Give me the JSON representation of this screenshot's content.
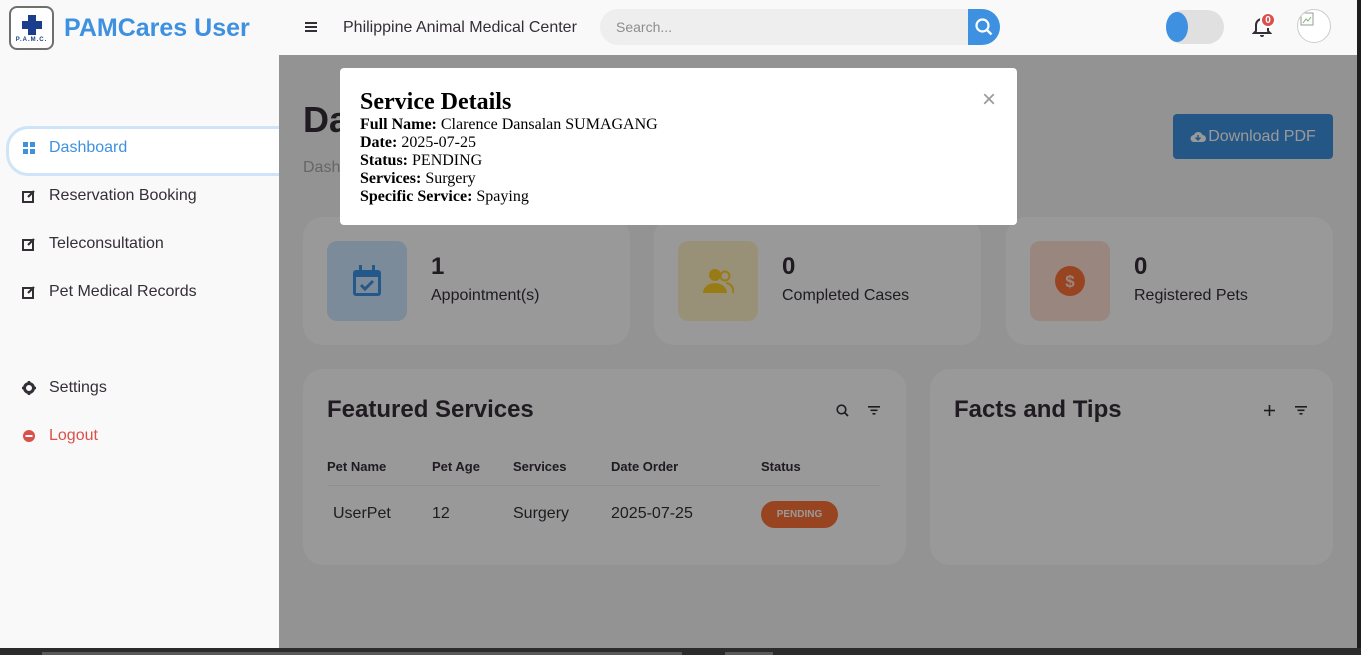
{
  "sidebar": {
    "brand": "PAMCares User",
    "logo_text": "P.A.M.C.",
    "items": [
      {
        "label": "Dashboard",
        "icon": "grid-icon"
      },
      {
        "label": "Reservation Booking",
        "icon": "edit-icon"
      },
      {
        "label": "Teleconsultation",
        "icon": "edit-icon"
      },
      {
        "label": "Pet Medical Records",
        "icon": "edit-icon"
      }
    ],
    "settings_label": "Settings",
    "logout_label": "Logout"
  },
  "topnav": {
    "title": "Philippine Animal Medical Center",
    "search_placeholder": "Search...",
    "notification_count": "0"
  },
  "main": {
    "page_title": "Da",
    "breadcrumb": "Dash",
    "download_label": "Download PDF",
    "stats": [
      {
        "value": "1",
        "label": "Appointment(s)",
        "color": "#cfe8ff",
        "icon_color": "#3c91e6"
      },
      {
        "value": "0",
        "label": "Completed Cases",
        "color": "#fff2c6",
        "icon_color": "#ffce26"
      },
      {
        "value": "0",
        "label": "Registered Pets",
        "color": "#ffe0d3",
        "icon_color": "#fd7238"
      }
    ],
    "featured": {
      "title": "Featured Services",
      "columns": [
        "Pet Name",
        "Pet Age",
        "Services",
        "Date Order",
        "Status"
      ],
      "rows": [
        {
          "pet_name": "UserPet",
          "pet_age": "12",
          "services": "Surgery",
          "date_order": "2025-07-25",
          "status": "PENDING"
        }
      ]
    },
    "facts": {
      "title": "Facts and Tips"
    }
  },
  "modal": {
    "title": "Service Details",
    "fields": [
      {
        "label": "Full Name:",
        "value": "Clarence Dansalan SUMAGANG"
      },
      {
        "label": "Date:",
        "value": "2025-07-25"
      },
      {
        "label": "Status:",
        "value": "PENDING"
      },
      {
        "label": "Services:",
        "value": "Surgery"
      },
      {
        "label": "Specific Service:",
        "value": "Spaying"
      }
    ],
    "close_symbol": "×"
  }
}
